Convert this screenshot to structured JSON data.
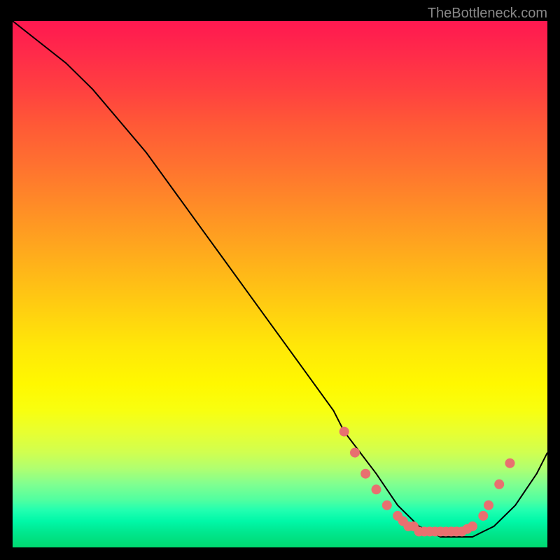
{
  "attribution": "TheBottleneck.com",
  "chart_data": {
    "type": "line",
    "title": "",
    "xlabel": "",
    "ylabel": "",
    "x": [
      0,
      5,
      10,
      15,
      20,
      25,
      30,
      35,
      40,
      45,
      50,
      55,
      60,
      62,
      65,
      68,
      70,
      72,
      74,
      76,
      78,
      80,
      82,
      84,
      86,
      88,
      90,
      92,
      94,
      96,
      98,
      100
    ],
    "y": [
      100,
      96,
      92,
      87,
      81,
      75,
      68,
      61,
      54,
      47,
      40,
      33,
      26,
      22,
      18,
      14,
      11,
      8,
      6,
      4,
      3,
      2,
      2,
      2,
      2,
      3,
      4,
      6,
      8,
      11,
      14,
      18
    ],
    "scatter_points": [
      {
        "x": 62,
        "y": 22
      },
      {
        "x": 64,
        "y": 18
      },
      {
        "x": 66,
        "y": 14
      },
      {
        "x": 68,
        "y": 11
      },
      {
        "x": 70,
        "y": 8
      },
      {
        "x": 72,
        "y": 6
      },
      {
        "x": 73,
        "y": 5
      },
      {
        "x": 74,
        "y": 4
      },
      {
        "x": 75,
        "y": 4
      },
      {
        "x": 76,
        "y": 3
      },
      {
        "x": 77,
        "y": 3
      },
      {
        "x": 78,
        "y": 3
      },
      {
        "x": 79,
        "y": 3
      },
      {
        "x": 80,
        "y": 3
      },
      {
        "x": 81,
        "y": 3
      },
      {
        "x": 82,
        "y": 3
      },
      {
        "x": 83,
        "y": 3
      },
      {
        "x": 84,
        "y": 3
      },
      {
        "x": 85,
        "y": 3.5
      },
      {
        "x": 86,
        "y": 4
      },
      {
        "x": 88,
        "y": 6
      },
      {
        "x": 89,
        "y": 8
      },
      {
        "x": 91,
        "y": 12
      },
      {
        "x": 93,
        "y": 16
      }
    ],
    "xlim": [
      0,
      100
    ],
    "ylim": [
      0,
      100
    ]
  }
}
